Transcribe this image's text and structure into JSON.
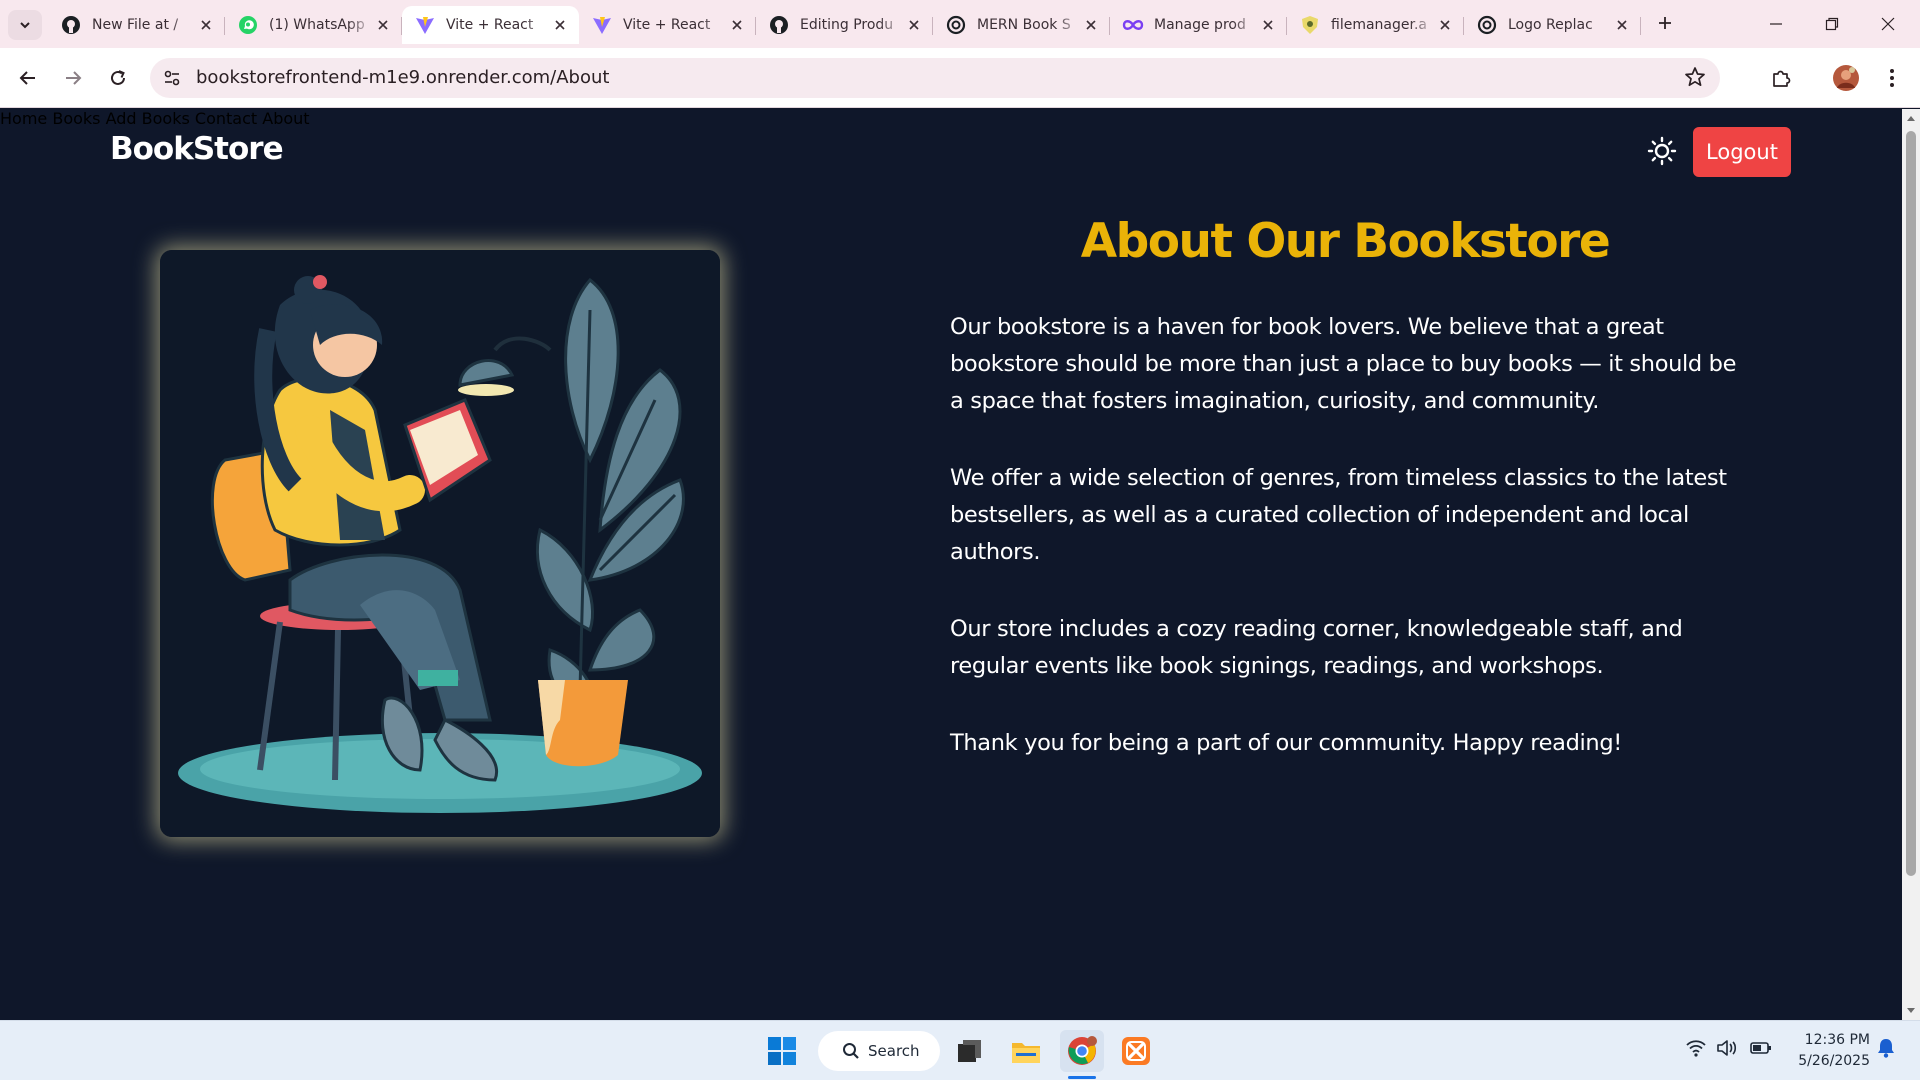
{
  "browser": {
    "tabs": [
      {
        "title": "New File at /",
        "icon": "github-icon"
      },
      {
        "title": "(1) WhatsApp",
        "icon": "whatsapp-icon"
      },
      {
        "title": "Vite + React",
        "icon": "vite-icon",
        "active": true
      },
      {
        "title": "Vite + React",
        "icon": "vite-icon"
      },
      {
        "title": "Editing Produ",
        "icon": "github-icon"
      },
      {
        "title": "MERN Book S",
        "icon": "openai-icon"
      },
      {
        "title": "Manage prod",
        "icon": "infinity-icon"
      },
      {
        "title": "filemanager.a",
        "icon": "shield-icon"
      },
      {
        "title": "Logo Replac",
        "icon": "openai-icon"
      }
    ],
    "url": "bookstorefrontend-m1e9.onrender.com/About"
  },
  "site": {
    "brand": "BookStore",
    "nav": [
      "Home",
      "Books",
      "Add Books",
      "Contact",
      "About"
    ],
    "logout_label": "Logout",
    "heading": "About Our Bookstore",
    "paragraphs": [
      "Our bookstore is a haven for book lovers. We believe that a great bookstore should be more than just a place to buy books — it should be a space that fosters imagination, curiosity, and community.",
      "We offer a wide selection of genres, from timeless classics to the latest bestsellers, as well as a curated collection of independent and local authors.",
      "Our store includes a cozy reading corner, knowledgeable staff, and regular events like book signings, readings, and workshops.",
      "Thank you for being a part of our community. Happy reading!"
    ]
  },
  "taskbar": {
    "search_label": "Search",
    "time": "12:36 PM",
    "date": "5/26/2025"
  },
  "colors": {
    "page_bg": "#0f172a",
    "heading": "#eab308",
    "logout": "#ef4444",
    "tab_strip": "#f8e8ee"
  }
}
